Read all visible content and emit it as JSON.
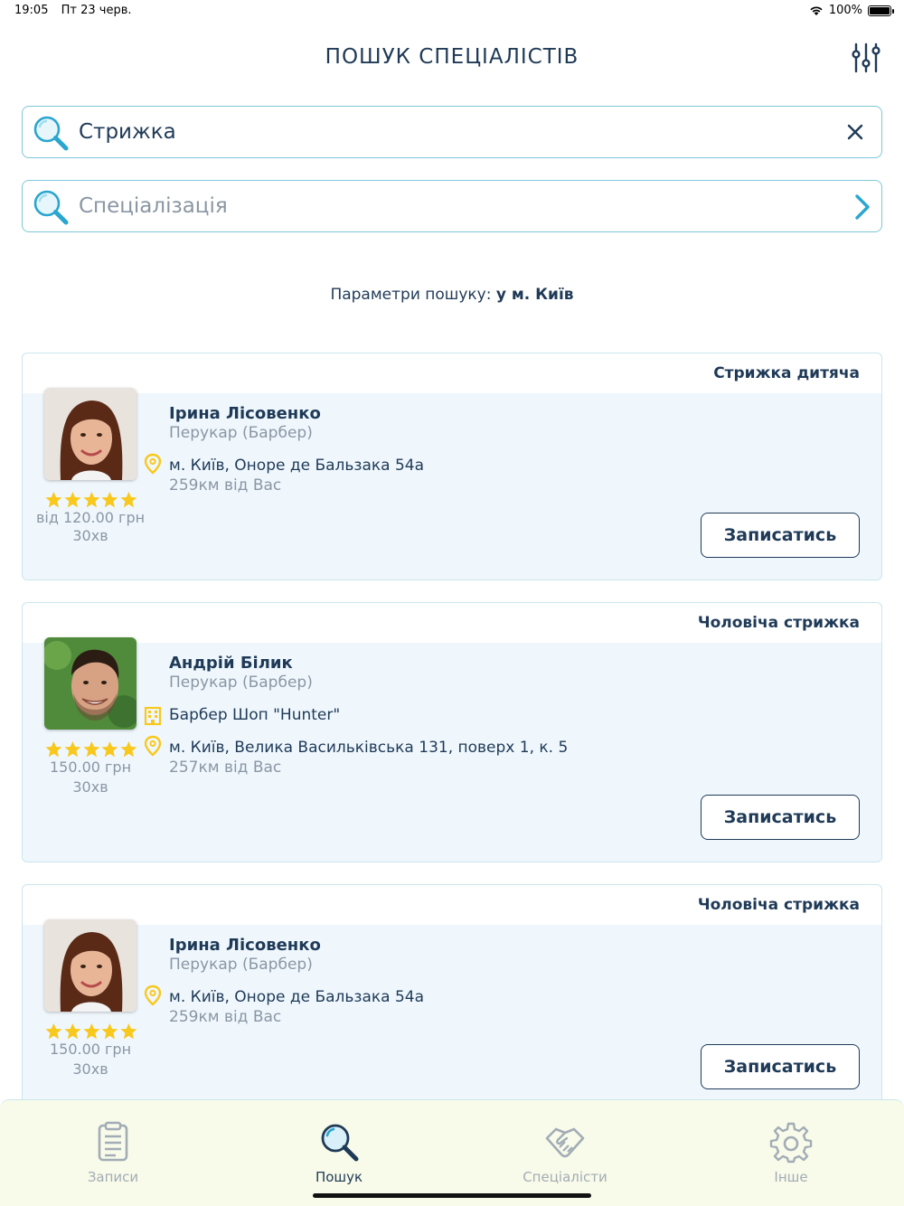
{
  "status_bar": {
    "time": "19:05",
    "date": "Пт 23 черв.",
    "battery": "100%",
    "battery_level": 1.0
  },
  "header": {
    "title": "ПОШУК СПЕЦІАЛІСТІВ"
  },
  "search": {
    "query_value": "Стрижка",
    "specialization_placeholder": "Спеціалізація"
  },
  "params": {
    "label": "Параметри пошуку:",
    "value": "у м. Київ"
  },
  "colors": {
    "primary": "#1f3a57",
    "accent": "#2aa6cf",
    "star": "#f8c81c",
    "pin": "#f8c81c",
    "card_body": "#eff7fd",
    "tabbar_bg": "#f8fbe9"
  },
  "results": [
    {
      "service": "Стрижка дитяча",
      "name": "Ірина Лісовенко",
      "role": "Перукар (Барбер)",
      "address": "м. Київ, Оноре де Бальзака 54а",
      "distance": "259км від Вас",
      "rating": 5,
      "price": "від 120.00 грн",
      "duration": "30хв",
      "book_label": "Записатись"
    },
    {
      "service": "Чоловіча стрижка",
      "name": "Андрій Білик",
      "role": "Перукар (Барбер)",
      "salon": "Барбер Шоп \"Hunter\"",
      "address": "м. Київ, Велика Васильківська 131, поверх 1, к. 5",
      "distance": "257км від Вас",
      "rating": 5,
      "price": "150.00 грн",
      "duration": "30хв",
      "book_label": "Записатись"
    },
    {
      "service": "Чоловіча стрижка",
      "name": "Ірина Лісовенко",
      "role": "Перукар (Барбер)",
      "address": "м. Київ, Оноре де Бальзака 54а",
      "distance": "259км від Вас",
      "rating": 5,
      "price": "150.00 грн",
      "duration": "30хв",
      "book_label": "Записатись"
    }
  ],
  "tabbar": [
    {
      "label": "Записи",
      "icon": "clipboard-icon",
      "active": false
    },
    {
      "label": "Пошук",
      "icon": "search-icon",
      "active": true
    },
    {
      "label": "Спеціалісти",
      "icon": "handshake-icon",
      "active": false
    },
    {
      "label": "Інше",
      "icon": "gear-icon",
      "active": false
    }
  ]
}
